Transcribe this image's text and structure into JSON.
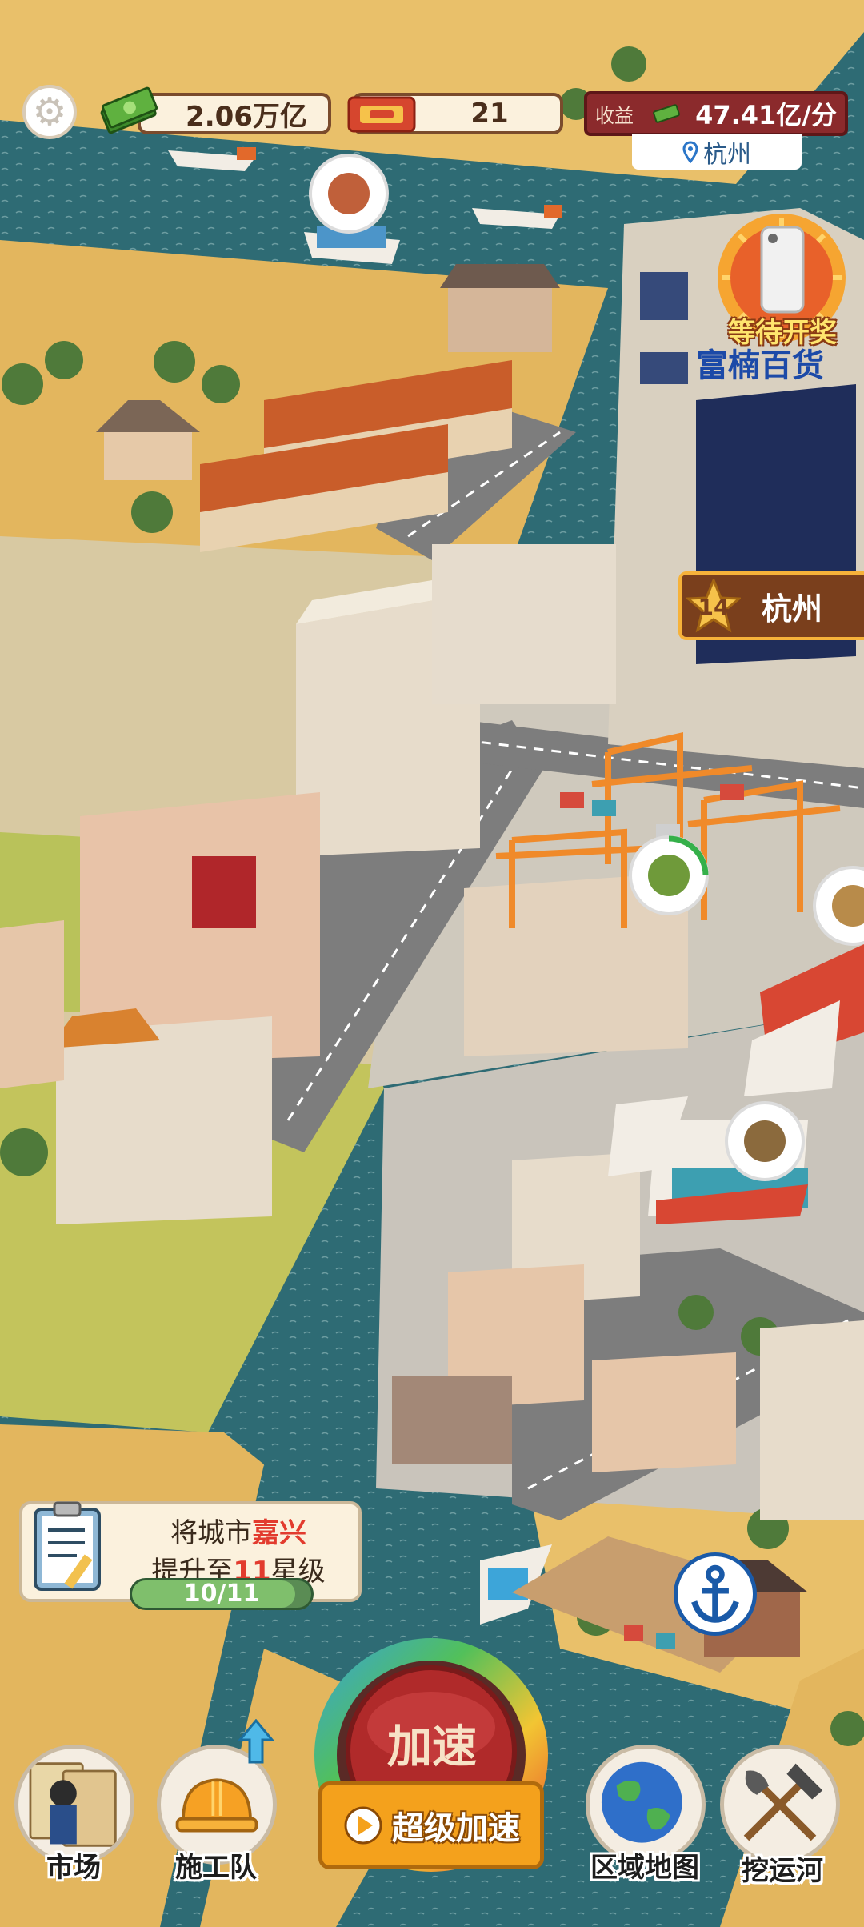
{
  "hud": {
    "cash_value": "2.06万亿",
    "ticket_count": "21",
    "income_label": "收益",
    "income_value": "47.41亿/分",
    "location": "杭州"
  },
  "lottery": {
    "label": "等待开奖",
    "store_sign": "富楠百货"
  },
  "city_badge": {
    "level": "14",
    "name": "杭州"
  },
  "task": {
    "line1_prefix": "将城市",
    "line1_city": "嘉兴",
    "line2_prefix": "提升至",
    "line2_level": "11",
    "line2_suffix": "星级",
    "progress_text": "10/11",
    "progress_fraction": 0.909
  },
  "bottom_bar": {
    "market_label": "市场",
    "construction_label": "施工队",
    "speed_label": "加速",
    "super_speed_label": "超级加速",
    "region_map_label": "区域地图",
    "canal_label": "挖运河"
  },
  "icons": {
    "settings": "gear-icon",
    "cash": "cash-stack-icon",
    "ticket": "ticket-icon",
    "pin": "location-pin-icon",
    "anchor": "anchor-icon",
    "play": "play-icon",
    "up_arrow": "up-arrow-icon"
  },
  "colors": {
    "water": "#2e6b74",
    "land": "#e9c06a",
    "grass": "#b9c25a",
    "income_panel": "#8b2a2c",
    "super_speed": "#f4a11c",
    "speed_red": "#b02a2a",
    "accent_red": "#e23b2e"
  }
}
